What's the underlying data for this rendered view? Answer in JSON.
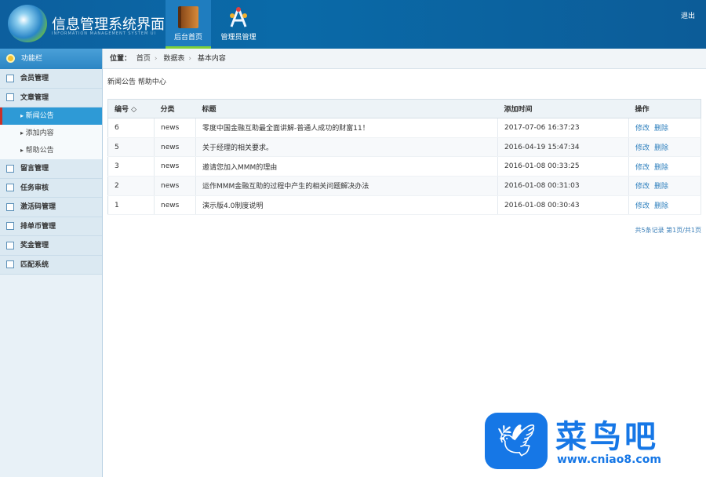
{
  "header": {
    "title": "信息管理系统界面",
    "subtitle": "INFORMATION MANAGEMENT SYSTEM UI",
    "nav": [
      {
        "label": "后台首页"
      },
      {
        "label": "管理员管理"
      }
    ],
    "logout": "退出"
  },
  "sidebar": {
    "title": "功能栏",
    "items": [
      {
        "label": "会员管理"
      },
      {
        "label": "文章管理",
        "children": [
          {
            "label": "新闻公告",
            "active": true
          },
          {
            "label": "添加内容"
          },
          {
            "label": "帮助公告"
          }
        ]
      },
      {
        "label": "留言管理"
      },
      {
        "label": "任务审核"
      },
      {
        "label": "激活码管理"
      },
      {
        "label": "排单币管理"
      },
      {
        "label": "奖金管理"
      },
      {
        "label": "匹配系统"
      }
    ]
  },
  "breadcrumb": {
    "prefix": "位置：",
    "items": [
      "首页",
      "数据表",
      "基本内容"
    ]
  },
  "tabs": "新闻公告 帮助中心",
  "table": {
    "headers": [
      "编号 ◇",
      "分类",
      "标题",
      "添加时间",
      "操作"
    ],
    "rows": [
      [
        "6",
        "news",
        "零度中国金融互助最全面讲解-普通人成功的财富11！",
        "2017-07-06 16:37:23"
      ],
      [
        "5",
        "news",
        "关于经理的相关要求。",
        "2016-04-19 15:47:34"
      ],
      [
        "3",
        "news",
        "邀请您加入MMM的理由",
        "2016-01-08 00:33:25"
      ],
      [
        "2",
        "news",
        "运作MMM金融互助的过程中产生的相关问题解决办法",
        "2016-01-08 00:31:03"
      ],
      [
        "1",
        "news",
        "演示版4.0制度说明",
        "2016-01-08 00:30:43"
      ]
    ],
    "actions": [
      "修改",
      "删除"
    ]
  },
  "pager": "共5条记录 第1页/共1页",
  "watermark": {
    "name": "菜鸟吧",
    "url": "www.cniao8.com"
  }
}
